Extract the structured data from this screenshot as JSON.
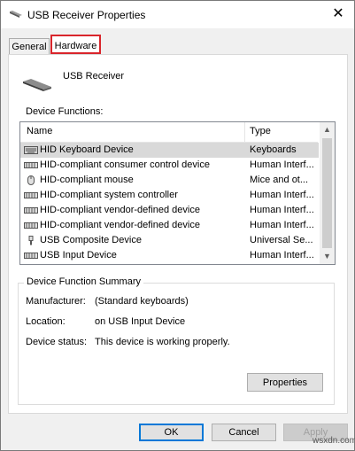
{
  "window": {
    "title": "USB Receiver Properties",
    "icon": "usb-receiver-icon"
  },
  "tabs": [
    {
      "label": "General"
    },
    {
      "label": "Hardware",
      "highlight_color": "#d9252b"
    }
  ],
  "device": {
    "name": "USB Receiver",
    "icon": "usb-receiver-icon"
  },
  "functions": {
    "label": "Device Functions:",
    "columns": {
      "name": "Name",
      "type": "Type"
    },
    "rows": [
      {
        "name": "HID Keyboard Device",
        "type": "Keyboards",
        "icon": "keyboard-icon",
        "selected": true
      },
      {
        "name": "HID-compliant consumer control device",
        "type": "Human Interf...",
        "icon": "hid-device-icon"
      },
      {
        "name": "HID-compliant mouse",
        "type": "Mice and ot...",
        "icon": "mouse-icon"
      },
      {
        "name": "HID-compliant system controller",
        "type": "Human Interf...",
        "icon": "hid-device-icon"
      },
      {
        "name": "HID-compliant vendor-defined device",
        "type": "Human Interf...",
        "icon": "hid-device-icon"
      },
      {
        "name": "HID-compliant vendor-defined device",
        "type": "Human Interf...",
        "icon": "hid-device-icon"
      },
      {
        "name": "USB Composite Device",
        "type": "Universal Se...",
        "icon": "usb-plug-icon"
      },
      {
        "name": "USB Input Device",
        "type": "Human Interf...",
        "icon": "hid-device-icon"
      }
    ]
  },
  "summary": {
    "title": "Device Function Summary",
    "manufacturer_label": "Manufacturer:",
    "manufacturer_value": "(Standard keyboards)",
    "location_label": "Location:",
    "location_value": "on USB Input Device",
    "status_label": "Device status:",
    "status_value": "This device is working properly.",
    "properties_button": "Properties"
  },
  "buttons": {
    "ok": "OK",
    "cancel": "Cancel",
    "apply": "Apply"
  },
  "watermark": "wsxdn.com"
}
